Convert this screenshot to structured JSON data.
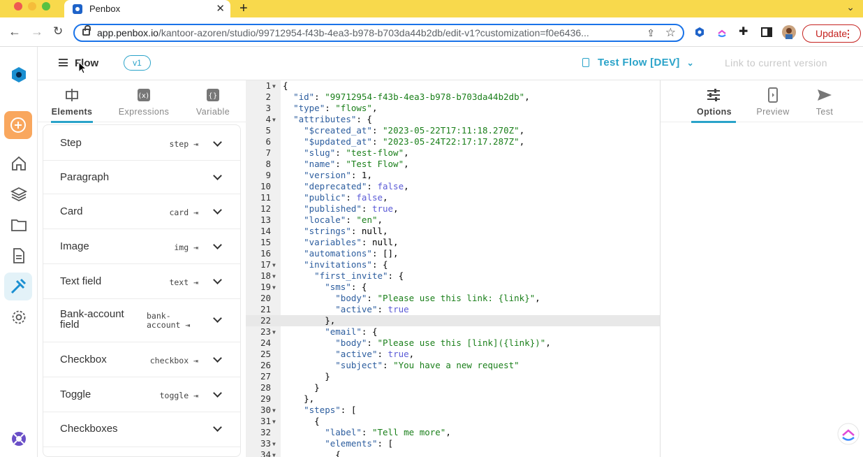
{
  "browser": {
    "tab_title": "Penbox",
    "url_host": "app.penbox.io",
    "url_path": "/kantoor-azoren/studio/99712954-f43b-4ea3-b978-b703da44b2db/edit-v1?customization=f0e6436...",
    "update_label": "Update"
  },
  "header": {
    "title": "Flow",
    "version_badge": "v1",
    "flow_selector": "Test Flow [DEV]",
    "link_current": "Link to current version"
  },
  "left_tabs": [
    {
      "label": "Elements",
      "active": true,
      "icon": "elements-icon"
    },
    {
      "label": "Expressions",
      "active": false,
      "icon": "expressions-icon"
    },
    {
      "label": "Variable",
      "active": false,
      "icon": "variable-icon"
    }
  ],
  "elements": [
    {
      "label": "Step",
      "tag": "step ⇥"
    },
    {
      "label": "Paragraph",
      "tag": ""
    },
    {
      "label": "Card",
      "tag": "card ⇥"
    },
    {
      "label": "Image",
      "tag": "img ⇥"
    },
    {
      "label": "Text field",
      "tag": "text ⇥"
    },
    {
      "label": "Bank-account field",
      "tag": "bank-account ⇥"
    },
    {
      "label": "Checkbox",
      "tag": "checkbox ⇥"
    },
    {
      "label": "Toggle",
      "tag": "toggle ⇥"
    },
    {
      "label": "Checkboxes",
      "tag": ""
    }
  ],
  "right_tabs": [
    {
      "label": "Options",
      "active": true,
      "icon": "sliders-icon"
    },
    {
      "label": "Preview",
      "active": false,
      "icon": "phone-icon"
    },
    {
      "label": "Test",
      "active": false,
      "icon": "send-icon"
    }
  ],
  "editor": {
    "active_line": 22,
    "lines": [
      {
        "n": "1",
        "fold": true,
        "html": "{"
      },
      {
        "n": "2",
        "fold": false,
        "html": "  <span class='k'>\"id\"</span>: <span class='s'>\"99712954-f43b-4ea3-b978-b703da44b2db\"</span>,"
      },
      {
        "n": "3",
        "fold": false,
        "html": "  <span class='k'>\"type\"</span>: <span class='s'>\"flows\"</span>,"
      },
      {
        "n": "4",
        "fold": true,
        "html": "  <span class='k'>\"attributes\"</span>: {"
      },
      {
        "n": "5",
        "fold": false,
        "html": "    <span class='k'>\"$created_at\"</span>: <span class='s'>\"2023-05-22T17:11:18.270Z\"</span>,"
      },
      {
        "n": "6",
        "fold": false,
        "html": "    <span class='k'>\"$updated_at\"</span>: <span class='s'>\"2023-05-24T22:17:17.287Z\"</span>,"
      },
      {
        "n": "7",
        "fold": false,
        "html": "    <span class='k'>\"slug\"</span>: <span class='s'>\"test-flow\"</span>,"
      },
      {
        "n": "8",
        "fold": false,
        "html": "    <span class='k'>\"name\"</span>: <span class='s'>\"Test Flow\"</span>,"
      },
      {
        "n": "9",
        "fold": false,
        "html": "    <span class='k'>\"version\"</span>: <span class='n'>1</span>,"
      },
      {
        "n": "10",
        "fold": false,
        "html": "    <span class='k'>\"deprecated\"</span>: <span class='b'>false</span>,"
      },
      {
        "n": "11",
        "fold": false,
        "html": "    <span class='k'>\"public\"</span>: <span class='b'>false</span>,"
      },
      {
        "n": "12",
        "fold": false,
        "html": "    <span class='k'>\"published\"</span>: <span class='b'>true</span>,"
      },
      {
        "n": "13",
        "fold": false,
        "html": "    <span class='k'>\"locale\"</span>: <span class='s'>\"en\"</span>,"
      },
      {
        "n": "14",
        "fold": false,
        "html": "    <span class='k'>\"strings\"</span>: null,"
      },
      {
        "n": "15",
        "fold": false,
        "html": "    <span class='k'>\"variables\"</span>: null,"
      },
      {
        "n": "16",
        "fold": false,
        "html": "    <span class='k'>\"automations\"</span>: [],"
      },
      {
        "n": "17",
        "fold": true,
        "html": "    <span class='k'>\"invitations\"</span>: {"
      },
      {
        "n": "18",
        "fold": true,
        "html": "      <span class='k'>\"first_invite\"</span>: {"
      },
      {
        "n": "19",
        "fold": true,
        "html": "        <span class='k'>\"sms\"</span>: {"
      },
      {
        "n": "20",
        "fold": false,
        "html": "          <span class='k'>\"body\"</span>: <span class='s'>\"Please use this link: {link}\"</span>,"
      },
      {
        "n": "21",
        "fold": false,
        "html": "          <span class='k'>\"active\"</span>: <span class='b'>true</span>"
      },
      {
        "n": "22",
        "fold": false,
        "html": "        },"
      },
      {
        "n": "23",
        "fold": true,
        "html": "        <span class='k'>\"email\"</span>: {"
      },
      {
        "n": "24",
        "fold": false,
        "html": "          <span class='k'>\"body\"</span>: <span class='s'>\"Please use this [link]({link})\"</span>,"
      },
      {
        "n": "25",
        "fold": false,
        "html": "          <span class='k'>\"active\"</span>: <span class='b'>true</span>,"
      },
      {
        "n": "26",
        "fold": false,
        "html": "          <span class='k'>\"subject\"</span>: <span class='s'>\"You have a new request\"</span>"
      },
      {
        "n": "27",
        "fold": false,
        "html": "        }"
      },
      {
        "n": "28",
        "fold": false,
        "html": "      }"
      },
      {
        "n": "29",
        "fold": false,
        "html": "    },"
      },
      {
        "n": "30",
        "fold": true,
        "html": "    <span class='k'>\"steps\"</span>: ["
      },
      {
        "n": "31",
        "fold": true,
        "html": "      {"
      },
      {
        "n": "32",
        "fold": false,
        "html": "        <span class='k'>\"label\"</span>: <span class='s'>\"Tell me more\"</span>,"
      },
      {
        "n": "33",
        "fold": true,
        "html": "        <span class='k'>\"elements\"</span>: ["
      },
      {
        "n": "34",
        "fold": true,
        "html": "          {"
      }
    ]
  }
}
